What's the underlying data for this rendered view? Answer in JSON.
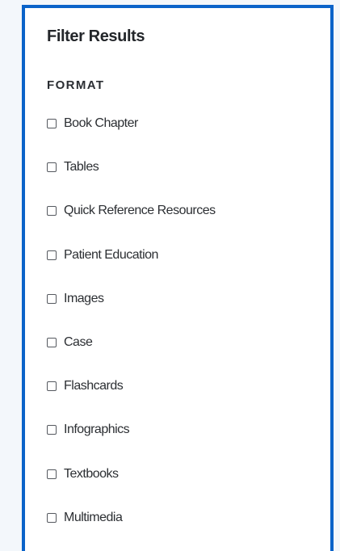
{
  "filter": {
    "title": "Filter Results",
    "section_heading": "FORMAT",
    "options": [
      {
        "label": "Book Chapter",
        "checked": false
      },
      {
        "label": "Tables",
        "checked": false
      },
      {
        "label": "Quick Reference Resources",
        "checked": false
      },
      {
        "label": "Patient Education",
        "checked": false
      },
      {
        "label": "Images",
        "checked": false
      },
      {
        "label": "Case",
        "checked": false
      },
      {
        "label": "Flashcards",
        "checked": false
      },
      {
        "label": "Infographics",
        "checked": false
      },
      {
        "label": "Textbooks",
        "checked": false
      },
      {
        "label": "Multimedia",
        "checked": false
      }
    ]
  },
  "colors": {
    "panel_border": "#0a63c9",
    "background": "#f3f7fb",
    "text": "#2c2f33"
  }
}
